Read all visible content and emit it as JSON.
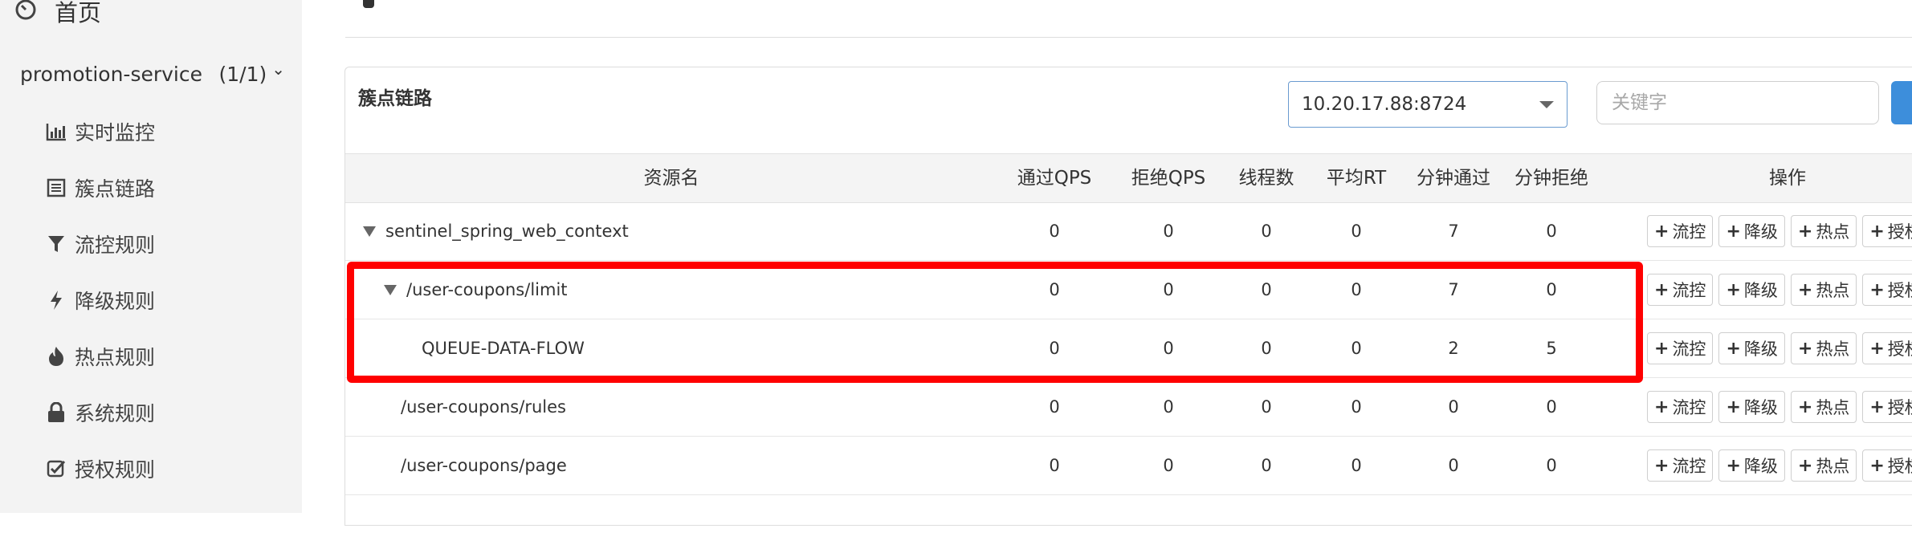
{
  "sidebar": {
    "home_label": "首页",
    "app": {
      "name": "promotion-service",
      "count": "(1/1)"
    },
    "items": [
      {
        "label": "实时监控",
        "icon": "bar-chart-icon"
      },
      {
        "label": "簇点链路",
        "icon": "list-icon"
      },
      {
        "label": "流控规则",
        "icon": "filter-icon"
      },
      {
        "label": "降级规则",
        "icon": "bolt-icon"
      },
      {
        "label": "热点规则",
        "icon": "fire-icon"
      },
      {
        "label": "系统规则",
        "icon": "lock-icon"
      },
      {
        "label": "授权规则",
        "icon": "check-square-icon"
      }
    ]
  },
  "panel": {
    "title": "簇点链路",
    "machine_select": {
      "value": "10.20.17.88:8724"
    },
    "search": {
      "placeholder": "关键字",
      "value": ""
    }
  },
  "table": {
    "headers": {
      "resource": "资源名",
      "pass_qps": "通过QPS",
      "block_qps": "拒绝QPS",
      "threads": "线程数",
      "avg_rt": "平均RT",
      "minute_pass": "分钟通过",
      "minute_block": "分钟拒绝",
      "ops": "操作"
    },
    "op_labels": {
      "flow": "流控",
      "degrade": "降级",
      "hotspot": "热点",
      "authority": "授权"
    },
    "rows": [
      {
        "name": "sentinel_spring_web_context",
        "pass_qps": "0",
        "block_qps": "0",
        "threads": "0",
        "avg_rt": "0",
        "minute_pass": "7",
        "minute_block": "0"
      },
      {
        "name": "/user-coupons/limit",
        "pass_qps": "0",
        "block_qps": "0",
        "threads": "0",
        "avg_rt": "0",
        "minute_pass": "7",
        "minute_block": "0"
      },
      {
        "name": "QUEUE-DATA-FLOW",
        "pass_qps": "0",
        "block_qps": "0",
        "threads": "0",
        "avg_rt": "0",
        "minute_pass": "2",
        "minute_block": "5"
      },
      {
        "name": "/user-coupons/rules",
        "pass_qps": "0",
        "block_qps": "0",
        "threads": "0",
        "avg_rt": "0",
        "minute_pass": "0",
        "minute_block": "0"
      },
      {
        "name": "/user-coupons/page",
        "pass_qps": "0",
        "block_qps": "0",
        "threads": "0",
        "avg_rt": "0",
        "minute_pass": "0",
        "minute_block": "0"
      }
    ]
  },
  "colors": {
    "highlight": "#ff0000",
    "accent": "#3d8edb"
  }
}
